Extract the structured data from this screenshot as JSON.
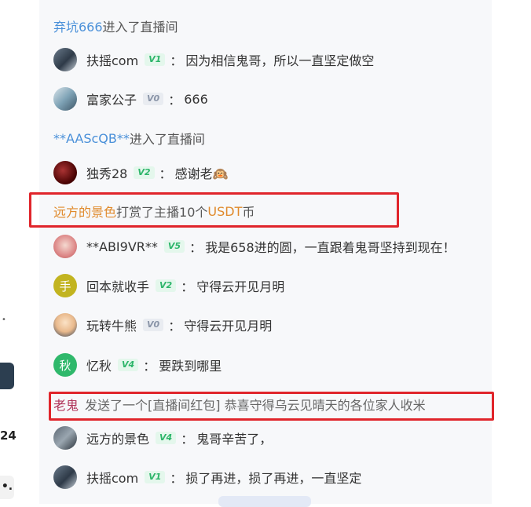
{
  "left": {
    "number": "24",
    "dots": "•.",
    "tick": "•"
  },
  "chat": {
    "notice1": {
      "name": "弃坑666",
      "text": "进入了直播间"
    },
    "msg1": {
      "avatar": "photo-avatar",
      "user": "扶摇com",
      "level": "V1",
      "text": "因为相信鬼哥，所以一直坚定做空"
    },
    "msg2": {
      "avatar": "photo-avatar",
      "user": "富家公子",
      "level": "V0",
      "text": "666"
    },
    "notice2": {
      "name": "**AAScQB**",
      "text": "进入了直播间"
    },
    "msg3": {
      "avatar": "photo-avatar",
      "user": "独秀28",
      "level": "V2",
      "text": "感谢老🙉"
    },
    "gift": {
      "giver": "远方的景色",
      "text1": "打赏了主播10个",
      "coin": "USDT",
      "text2": "币"
    },
    "msg4": {
      "avatar": "photo-avatar",
      "user": "**ABI9VR**",
      "level": "V5",
      "text": "我是658进的圆，一直跟着鬼哥坚持到现在！"
    },
    "msg5": {
      "avatar": "手",
      "user": "回本就收手",
      "level": "V2",
      "text": "守得云开见月明"
    },
    "msg6": {
      "avatar": "photo-avatar",
      "user": "玩转牛熊",
      "level": "V0",
      "text": "守得云开见月明"
    },
    "msg7": {
      "avatar": "秋",
      "user": "忆秋",
      "level": "V4",
      "text": "要跌到哪里"
    },
    "redpack": {
      "who": "老鬼",
      "text": "发送了一个[直播间红包] 恭喜守得乌云见晴天的各位家人收米"
    },
    "msg8": {
      "avatar": "photo-avatar",
      "user": "远方的景色",
      "level": "V4",
      "text": "鬼哥辛苦了，"
    },
    "msg9": {
      "avatar": "photo-avatar",
      "user": "扶摇com",
      "level": "V1",
      "text": "损了再进，损了再进，一直坚定"
    },
    "colon": "："
  },
  "colors": {
    "notice_name": "#4a90d9",
    "gift": "#e08a2c",
    "redpack_name": "#b0345a",
    "highlight": "#e0252b",
    "level_green": "#2db56a",
    "level_gray": "#8a95a8"
  }
}
